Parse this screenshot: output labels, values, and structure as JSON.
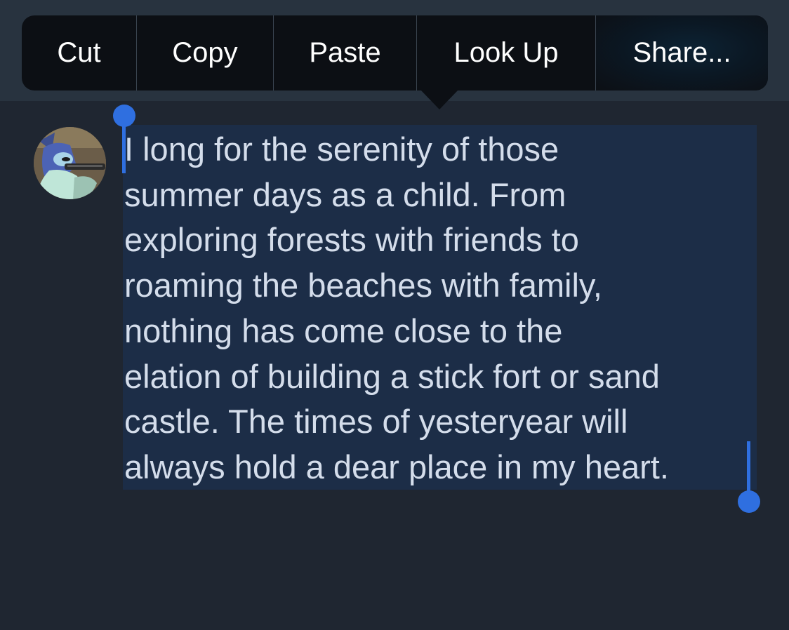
{
  "edit_menu": {
    "items": [
      {
        "label": "Cut"
      },
      {
        "label": "Copy"
      },
      {
        "label": "Paste"
      },
      {
        "label": "Look Up"
      },
      {
        "label": "Share..."
      }
    ]
  },
  "tweet": {
    "lines": [
      "I long for the serenity of those",
      "summer days as a child. From",
      "exploring forests with friends to",
      "roaming the beaches with family,",
      "nothing has come close to the",
      "elation of building a stick fort or sand",
      "castle. The times of yesteryear will",
      "always hold a dear place in my heart."
    ]
  },
  "colors": {
    "background": "#1f2631",
    "menu_background": "#0c0f14",
    "selection_highlight": "#1c2d47",
    "selection_handle": "#2f6fe0",
    "text": "#d4ddeb"
  }
}
